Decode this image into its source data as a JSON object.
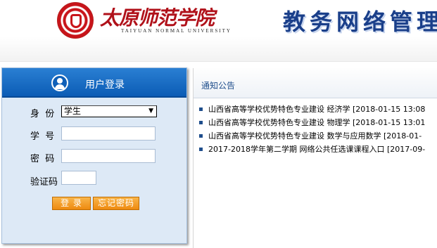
{
  "header": {
    "school_name_cn": "太原师范学院",
    "school_name_en": "TAIYUAN NORMAL UNIVERSITY",
    "system_title": "教务网络管理"
  },
  "login": {
    "title": "用户登录",
    "identity_label": "身  份",
    "identity_value": "学生",
    "student_id_label": "学  号",
    "password_label": "密  码",
    "captcha_label": "验证码",
    "login_button": "登 录",
    "forgot_button": "忘记密码"
  },
  "notices": {
    "title": "通知公告",
    "items": [
      "山西省高等学校优势特色专业建设 经济学 [2018-01-15 13:08",
      "山西省高等学校优势特色专业建设 物理学 [2018-01-15 13:01",
      "山西省高等学校优势特色专业建设 数学与应用数学 [2018-01-",
      "2017-2018学年第二学期 网络公共任选课课程入口 [2017-09-"
    ]
  },
  "icons": {
    "user": "user-circle-icon",
    "bullet": "square-bullet-icon",
    "dropdown": "chevron-down-icon"
  },
  "colors": {
    "header_blue": "#0b5cb5",
    "button_orange": "#ee8a10",
    "school_red": "#b0111a",
    "title_blue": "#1a3f8a"
  }
}
